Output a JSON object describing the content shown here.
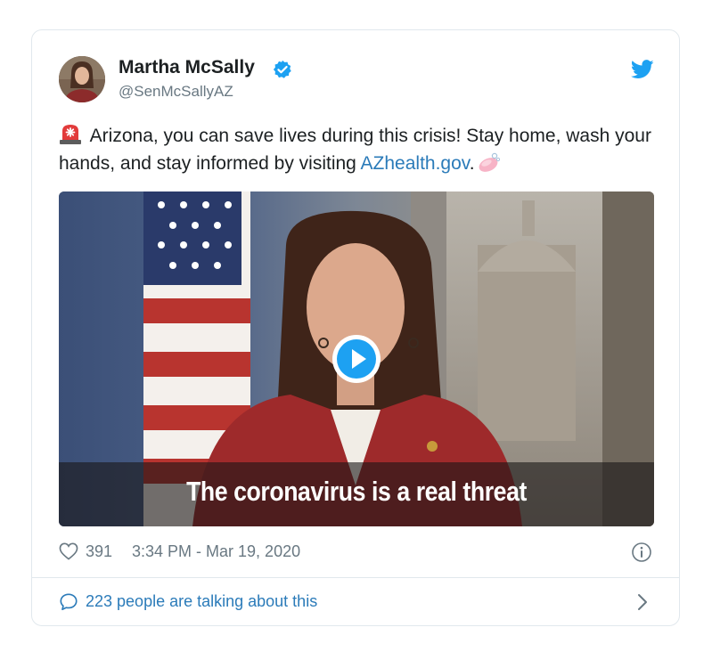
{
  "author": {
    "name": "Martha McSally",
    "handle": "@SenMcSallyAZ",
    "verified_icon": "verified-badge-icon",
    "avatar_icon": "profile-photo"
  },
  "brand": {
    "icon": "twitter-bird-icon",
    "color": "#1da1f2"
  },
  "tweet": {
    "leading_emoji": "rotating-siren-emoji",
    "text_part1": " Arizona, you can save lives during this crisis! Stay home, wash your hands, and stay informed by visiting ",
    "link_text": "AZhealth.gov",
    "text_part2": ".",
    "trailing_emoji": "soap-emoji",
    "link_color": "#2b7bb9"
  },
  "video": {
    "caption": "The coronavirus is a real threat",
    "play_icon": "play-button-icon"
  },
  "meta": {
    "like_count": "391",
    "timestamp": "3:34 PM - Mar 19, 2020",
    "heart_icon": "heart-icon",
    "info_icon": "info-icon"
  },
  "footer": {
    "talking_text": "223 people are talking about this",
    "bubble_icon": "speech-bubble-icon",
    "chevron_icon": "chevron-right-icon"
  }
}
